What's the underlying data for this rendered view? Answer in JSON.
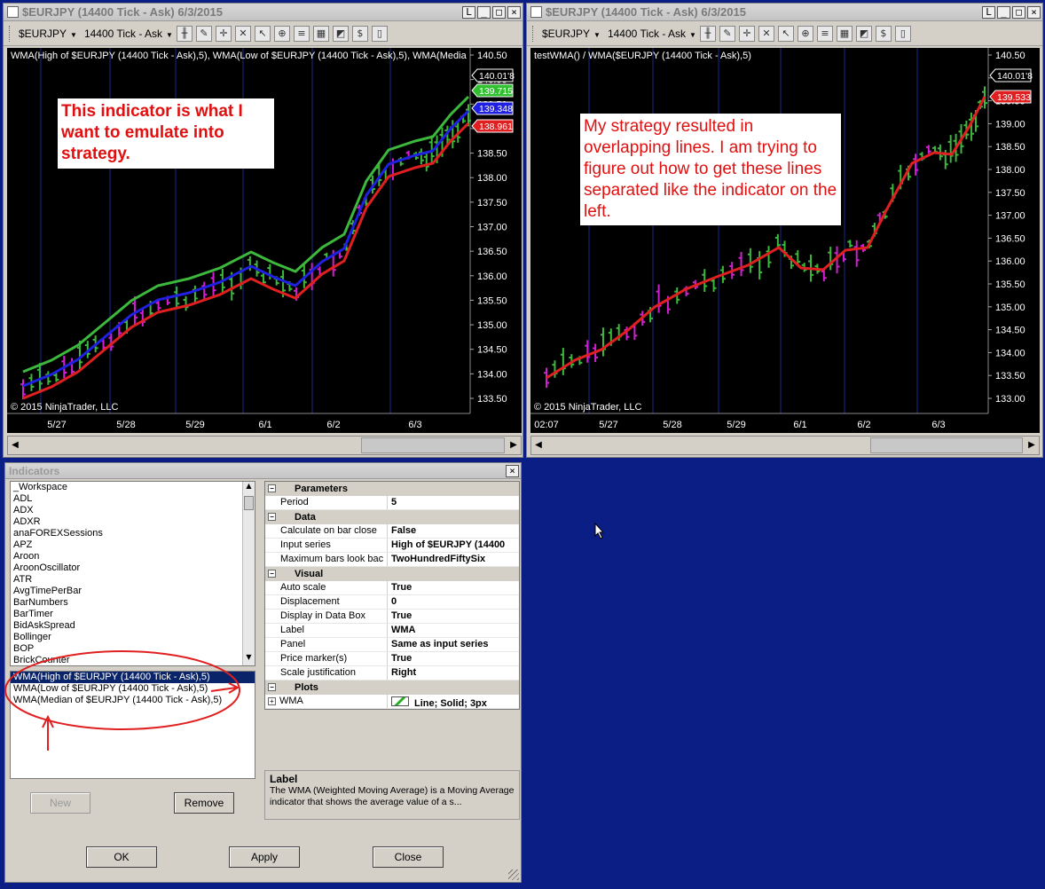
{
  "left_window": {
    "title": "$EURJPY (14400 Tick - Ask)  6/3/2015",
    "instrument": "$EURJPY",
    "interval": "14400 Tick - Ask",
    "indicator_label": "WMA(High of $EURJPY (14400 Tick - Ask),5), WMA(Low of $EURJPY (14400 Tick - Ask),5), WMA(Media",
    "copyright": "© 2015 NinjaTrader, LLC",
    "y_ticks": [
      "140.50",
      "140.00",
      "139.50",
      "139.00",
      "138.50",
      "138.00",
      "137.50",
      "137.00",
      "136.50",
      "136.00",
      "135.50",
      "135.00",
      "134.50",
      "134.00",
      "133.50"
    ],
    "x_ticks": [
      "5/27",
      "5/28",
      "5/29",
      "6/1",
      "6/2",
      "6/3"
    ],
    "price_markers": [
      {
        "text": "140.01'8",
        "color": "#000000"
      },
      {
        "text": "139.715",
        "color": "#30c030"
      },
      {
        "text": "139.348",
        "color": "#2020e0"
      },
      {
        "text": "138.961",
        "color": "#e02020"
      }
    ],
    "note": "This indicator is what I want to emulate into strategy."
  },
  "right_window": {
    "title": "$EURJPY (14400 Tick - Ask)  6/3/2015",
    "instrument": "$EURJPY",
    "interval": "14400 Tick - Ask",
    "indicator_label": "testWMA() / WMA($EURJPY (14400 Tick - Ask),5)",
    "copyright": "© 2015 NinjaTrader, LLC",
    "y_ticks": [
      "140.50",
      "140.00",
      "139.50",
      "139.00",
      "138.50",
      "138.00",
      "137.50",
      "137.00",
      "136.50",
      "136.00",
      "135.50",
      "135.00",
      "134.50",
      "134.00",
      "133.50",
      "133.00"
    ],
    "x_ticks": [
      "02:07",
      "5/27",
      "5/28",
      "5/29",
      "6/1",
      "6/2",
      "6/3"
    ],
    "price_markers": [
      {
        "text": "140.01'8",
        "color": "#000000"
      },
      {
        "text": "139.533",
        "color": "#e02020"
      }
    ],
    "note": "My strategy resulted in overlapping lines. I am trying to figure out how to get these lines separated like the indicator on the left."
  },
  "dialog": {
    "title": "Indicators",
    "available": [
      "_Workspace",
      "ADL",
      "ADX",
      "ADXR",
      "anaFOREXSessions",
      "APZ",
      "Aroon",
      "AroonOscillator",
      "ATR",
      "AvgTimePerBar",
      "BarNumbers",
      "BarTimer",
      "BidAskSpread",
      "Bollinger",
      "BOP",
      "BrickCounter"
    ],
    "applied": [
      "WMA(High of $EURJPY (14400 Tick - Ask),5)",
      "WMA(Low of $EURJPY (14400 Tick - Ask),5)",
      "WMA(Median of $EURJPY (14400 Tick - Ask),5)"
    ],
    "properties": [
      {
        "cat": "Parameters"
      },
      {
        "k": "Period",
        "v": "5"
      },
      {
        "cat": "Data"
      },
      {
        "k": "Calculate on bar close",
        "v": "False"
      },
      {
        "k": "Input series",
        "v": "High of $EURJPY (14400"
      },
      {
        "k": "Maximum bars look bac",
        "v": "TwoHundredFiftySix"
      },
      {
        "cat": "Visual"
      },
      {
        "k": "Auto scale",
        "v": "True"
      },
      {
        "k": "Displacement",
        "v": "0"
      },
      {
        "k": "Display in Data Box",
        "v": "True"
      },
      {
        "k": "Label",
        "v": "WMA"
      },
      {
        "k": "Panel",
        "v": "Same as input series"
      },
      {
        "k": "Price marker(s)",
        "v": "True"
      },
      {
        "k": "Scale justification",
        "v": "Right"
      },
      {
        "cat": "Plots"
      },
      {
        "k": "WMA",
        "v": "Line; Solid; 3px",
        "plus": true
      }
    ],
    "desc_title": "Label",
    "desc_text": "The WMA (Weighted Moving Average) is a Moving Average indicator that shows the average value of a s...",
    "buttons": {
      "new": "New",
      "remove": "Remove",
      "ok": "OK",
      "apply": "Apply",
      "close": "Close"
    }
  }
}
